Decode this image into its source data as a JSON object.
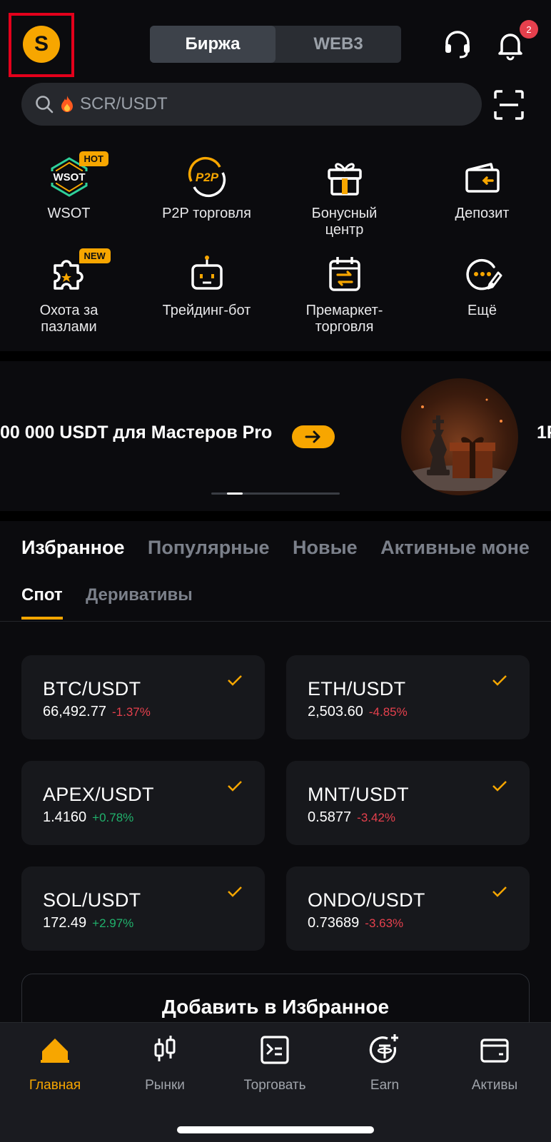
{
  "header": {
    "avatar_letter": "S",
    "segments": [
      {
        "label": "Биржа",
        "active": true
      },
      {
        "label": "WEB3",
        "active": false
      }
    ],
    "notification_count": "2"
  },
  "search": {
    "placeholder": "SCR/USDT",
    "icon": "fire-icon"
  },
  "shortcuts": [
    {
      "label": "WSOT",
      "tag": "HOT",
      "icon": "wsot-icon"
    },
    {
      "label": "P2P торговля",
      "tag": "",
      "icon": "p2p-icon"
    },
    {
      "label": "Бонусный центр",
      "tag": "",
      "icon": "gift-icon"
    },
    {
      "label": "Депозит",
      "tag": "",
      "icon": "wallet-deposit-icon"
    },
    {
      "label": "Охота за пазлами",
      "tag": "NEW",
      "icon": "puzzle-icon"
    },
    {
      "label": "Трейдинг-бот",
      "tag": "",
      "icon": "robot-icon"
    },
    {
      "label": "Премаркет-торговля",
      "tag": "",
      "icon": "calendar-swap-icon"
    },
    {
      "label": "Ещё",
      "tag": "",
      "icon": "more-icon"
    }
  ],
  "banner": {
    "text": "00 000 USDT для Мастеров Pro",
    "next_text": "1F",
    "slide_index": 1,
    "slide_count": 4
  },
  "market_tabs": [
    "Избранное",
    "Популярные",
    "Новые",
    "Активные моне"
  ],
  "market_subtabs": [
    "Спот",
    "Деривативы"
  ],
  "favorites": [
    {
      "pair": "BTC/USDT",
      "price": "66,492.77",
      "change": "-1.37%",
      "dir": "neg"
    },
    {
      "pair": "ETH/USDT",
      "price": "2,503.60",
      "change": "-4.85%",
      "dir": "neg"
    },
    {
      "pair": "APEX/USDT",
      "price": "1.4160",
      "change": "+0.78%",
      "dir": "pos"
    },
    {
      "pair": "MNT/USDT",
      "price": "0.5877",
      "change": "-3.42%",
      "dir": "neg"
    },
    {
      "pair": "SOL/USDT",
      "price": "172.49",
      "change": "+2.97%",
      "dir": "pos"
    },
    {
      "pair": "ONDO/USDT",
      "price": "0.73689",
      "change": "-3.63%",
      "dir": "neg"
    }
  ],
  "add_favorites_label": "Добавить в Избранное",
  "nav": [
    {
      "label": "Главная",
      "icon": "home-icon",
      "active": true
    },
    {
      "label": "Рынки",
      "icon": "candles-icon",
      "active": false
    },
    {
      "label": "Торговать",
      "icon": "terminal-icon",
      "active": false
    },
    {
      "label": "Earn",
      "icon": "tether-plus-icon",
      "active": false
    },
    {
      "label": "Активы",
      "icon": "wallet-icon",
      "active": false
    }
  ],
  "colors": {
    "accent": "#f7a600",
    "negative": "#e5404d",
    "positive": "#20b26c",
    "background": "#0b0b0e"
  }
}
